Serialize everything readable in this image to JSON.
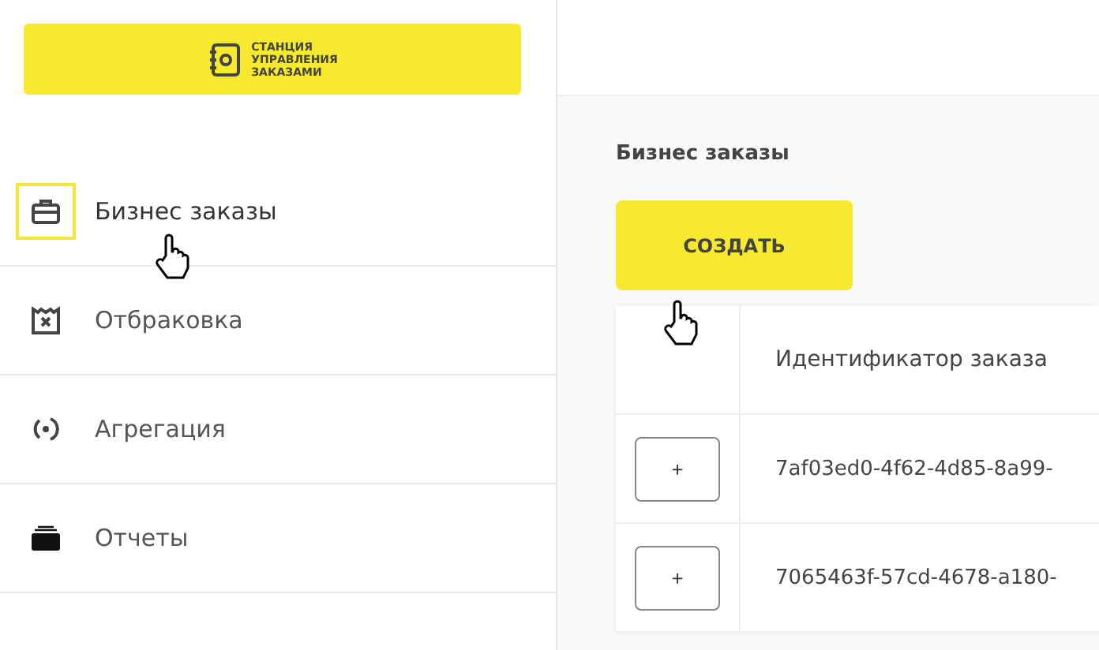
{
  "logo": {
    "lines": [
      "СТАНЦИЯ",
      "УПРАВЛЕНИЯ",
      "ЗАКАЗАМИ"
    ]
  },
  "sidebar": {
    "items": [
      {
        "label": "Бизнес заказы",
        "selected": true
      },
      {
        "label": "Отбраковка",
        "selected": false
      },
      {
        "label": "Агрегация",
        "selected": false
      },
      {
        "label": "Отчеты",
        "selected": false
      }
    ]
  },
  "page": {
    "title": "Бизнес заказы",
    "create_button": "СОЗДАТЬ"
  },
  "table": {
    "columns": [
      "Идентификатор заказа"
    ],
    "rows": [
      {
        "expand": "+",
        "id": "7af03ed0-4f62-4d85-8a99-"
      },
      {
        "expand": "+",
        "id": "7065463f-57cd-4678-a180-"
      }
    ]
  }
}
